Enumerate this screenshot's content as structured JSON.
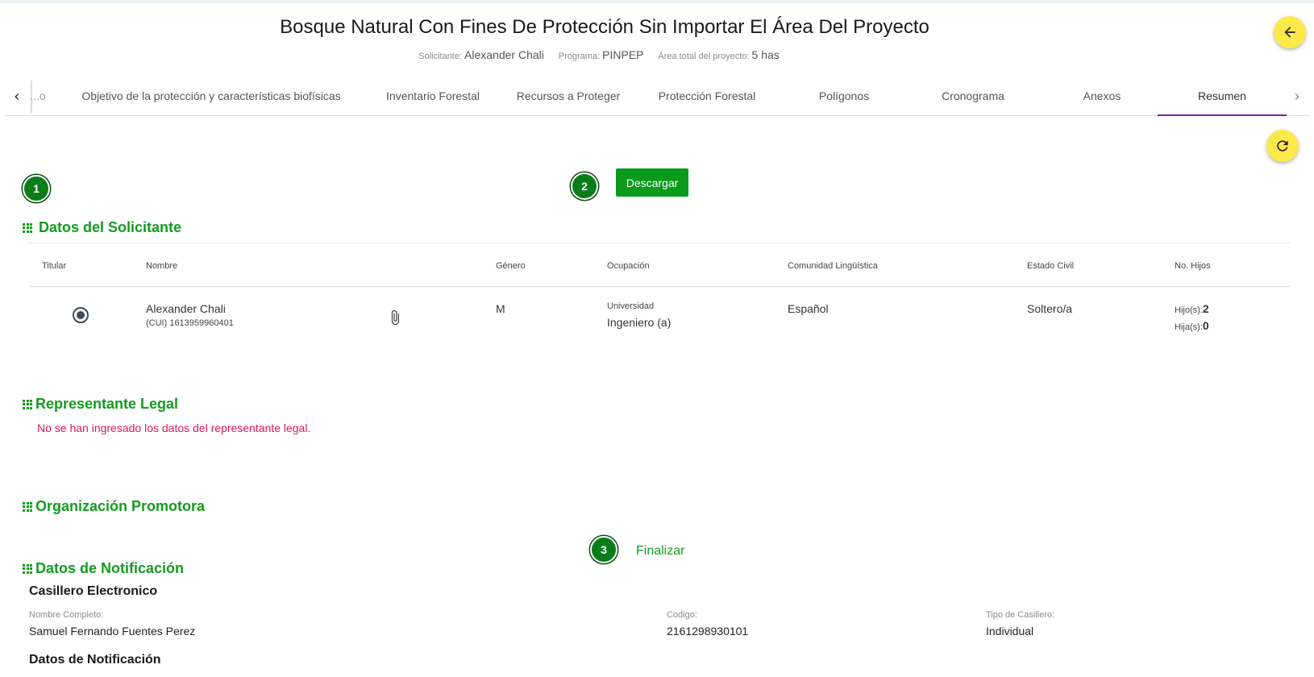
{
  "header": {
    "title": "Bosque Natural Con Fines De Protección Sin Importar El Área Del Proyecto",
    "solicitante_label": "Solicitante:",
    "solicitante_value": "Alexander Chali",
    "programa_label": "Programa:",
    "programa_value": "PINPEP",
    "area_label": "Área total del proyecto:",
    "area_value": "5 has"
  },
  "tabs": [
    {
      "label": "...o"
    },
    {
      "label": "Objetivo de la protección y características biofísicas"
    },
    {
      "label": "Inventario Forestal"
    },
    {
      "label": "Recursos a Proteger"
    },
    {
      "label": "Protección Forestal"
    },
    {
      "label": "Polígonos"
    },
    {
      "label": "Cronograma"
    },
    {
      "label": "Anexos"
    },
    {
      "label": "Resumen",
      "active": true
    }
  ],
  "steps": [
    "1",
    "2",
    "3"
  ],
  "download_label": "Descargar",
  "finalizar_label": "Finalizar",
  "sections": {
    "solicitante": "Datos del Solicitante",
    "representante": "Representante Legal",
    "organizacion": "Organización Promotora",
    "notificacion": "Datos de Notificación"
  },
  "table": {
    "headers": [
      "Titular",
      "Nombre",
      "Género",
      "Ocupación",
      "Comunidad Lingüística",
      "Estado Civil",
      "No. Hijos"
    ],
    "row": {
      "nombre": "Alexander Chali",
      "cui": "(CUI) 1613959960401",
      "genero": "M",
      "ocupacion_nivel": "Universidad",
      "ocupacion": "Ingeniero (a)",
      "comunidad": "Español",
      "estado_civil": "Soltero/a",
      "hijos_label": "Hijo(s):",
      "hijos": "2",
      "hijas_label": "Hija(s):",
      "hijas": "0"
    }
  },
  "representante_msg": "No se han ingresado los datos del representante legal.",
  "notificacion": {
    "casillero_title": "Casillero Electronico",
    "nombre_label": "Nombre Completo:",
    "nombre_value": "Samuel Fernando Fuentes Perez",
    "codigo_label": "Codigo:",
    "codigo_value": "2161298930101",
    "tipo_label": "Tipo de Casillero:",
    "tipo_value": "Individual",
    "datos_title": "Datos de Notificación"
  },
  "colors": {
    "accent": "#139c1f",
    "fab": "#fde84a",
    "warn": "#e0155a",
    "tab_active": "#7b1fa2"
  }
}
